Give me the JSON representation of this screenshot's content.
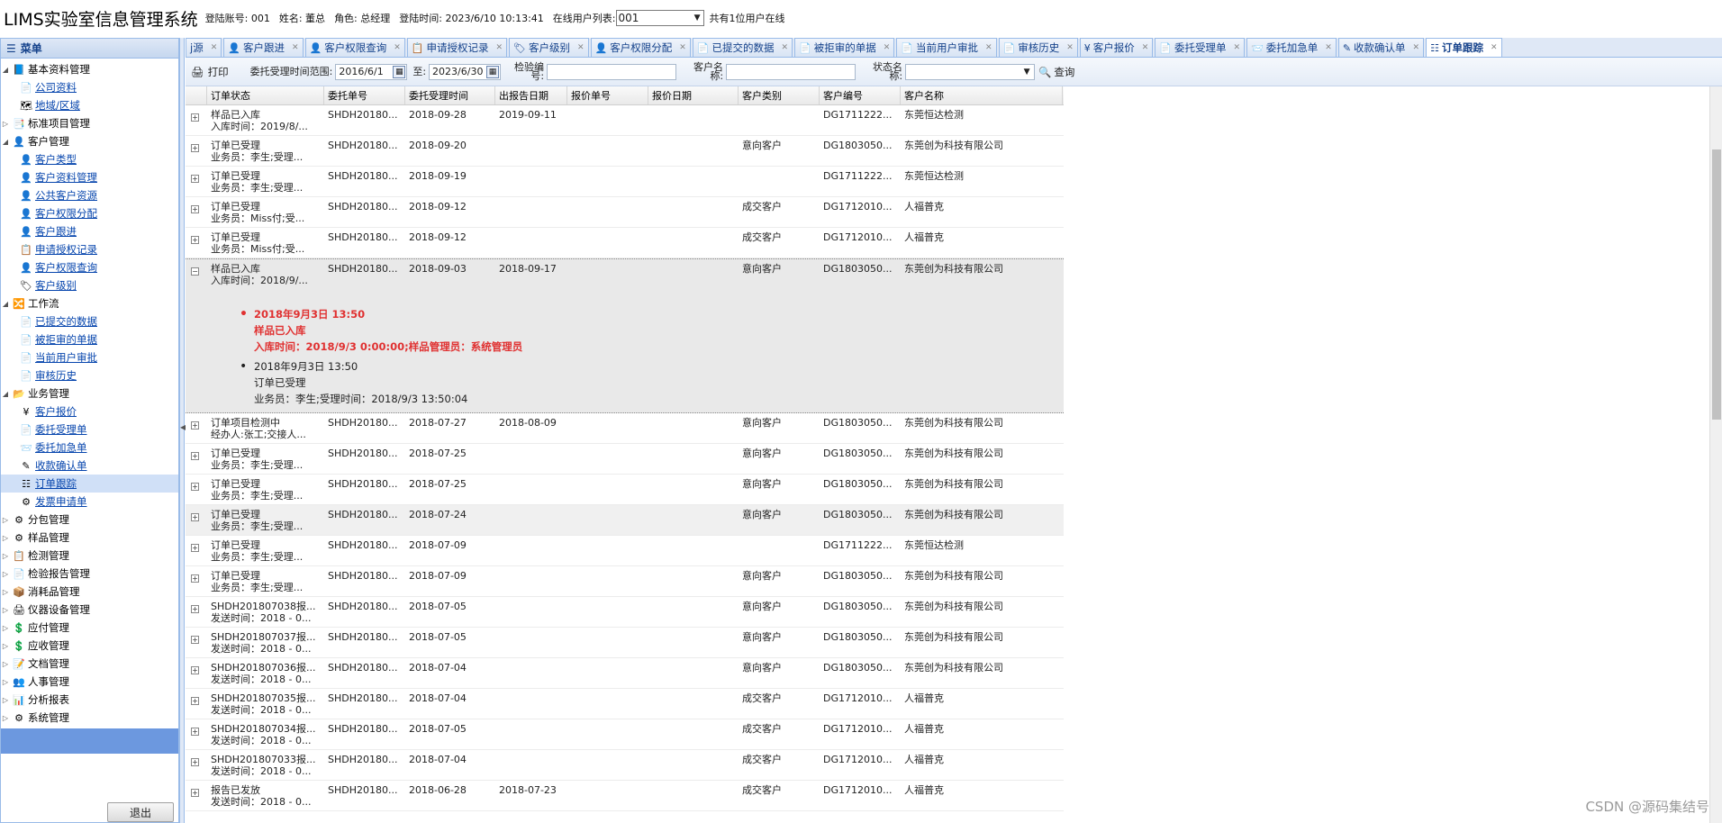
{
  "header": {
    "title": "LIMS实验室信息管理系统",
    "account": "登陆账号: 001",
    "name": "姓名: 董总",
    "role": "角色: 总经理",
    "login_time": "登陆时间: 2023/6/10 10:13:41",
    "online_label": "在线用户列表:",
    "online_value": "001",
    "online_count": "共有1位用户在线"
  },
  "menu": {
    "title": "菜单",
    "logout": "退出",
    "items": [
      {
        "label": "基本资料管理",
        "level": 0,
        "icon": "📘"
      },
      {
        "label": "公司资料",
        "level": 1,
        "icon": "📄"
      },
      {
        "label": "地域/区域",
        "level": 1,
        "icon": "🗺"
      },
      {
        "label": "标准项目管理",
        "level": 0,
        "icon": "📑"
      },
      {
        "label": "客户管理",
        "level": 0,
        "icon": "👤"
      },
      {
        "label": "客户类型",
        "level": 1,
        "icon": "👤"
      },
      {
        "label": "客户资料管理",
        "level": 1,
        "icon": "👤"
      },
      {
        "label": "公共客户资源",
        "level": 1,
        "icon": "👤"
      },
      {
        "label": "客户权限分配",
        "level": 1,
        "icon": "👤"
      },
      {
        "label": "客户跟进",
        "level": 1,
        "icon": "👤"
      },
      {
        "label": "申请授权记录",
        "level": 1,
        "icon": "📋"
      },
      {
        "label": "客户权限查询",
        "level": 1,
        "icon": "👤"
      },
      {
        "label": "客户级别",
        "level": 1,
        "icon": "🏷"
      },
      {
        "label": "工作流",
        "level": 0,
        "icon": "🔀"
      },
      {
        "label": "已提交的数据",
        "level": 1,
        "icon": "📄"
      },
      {
        "label": "被拒审的单据",
        "level": 1,
        "icon": "📄"
      },
      {
        "label": "当前用户审批",
        "level": 1,
        "icon": "📄"
      },
      {
        "label": "审核历史",
        "level": 1,
        "icon": "📄"
      },
      {
        "label": "业务管理",
        "level": 0,
        "icon": "📂"
      },
      {
        "label": "客户报价",
        "level": 1,
        "icon": "¥"
      },
      {
        "label": "委托受理单",
        "level": 1,
        "icon": "📄"
      },
      {
        "label": "委托加急单",
        "level": 1,
        "icon": "📨"
      },
      {
        "label": "收款确认单",
        "level": 1,
        "icon": "✎"
      },
      {
        "label": "订单跟踪",
        "level": 1,
        "icon": "☷"
      },
      {
        "label": "发票申请单",
        "level": 1,
        "icon": "⚙"
      },
      {
        "label": "分包管理",
        "level": 0,
        "icon": "⚙"
      },
      {
        "label": "样品管理",
        "level": 0,
        "icon": "⚙"
      },
      {
        "label": "检测管理",
        "level": 0,
        "icon": "📋"
      },
      {
        "label": "检验报告管理",
        "level": 0,
        "icon": "📄"
      },
      {
        "label": "消耗品管理",
        "level": 0,
        "icon": "📦"
      },
      {
        "label": "仪器设备管理",
        "level": 0,
        "icon": "🖨"
      },
      {
        "label": "应付管理",
        "level": 0,
        "icon": "💲"
      },
      {
        "label": "应收管理",
        "level": 0,
        "icon": "💲"
      },
      {
        "label": "文档管理",
        "level": 0,
        "icon": "📝"
      },
      {
        "label": "人事管理",
        "level": 0,
        "icon": "👥"
      },
      {
        "label": "分析报表",
        "level": 0,
        "icon": "📊"
      },
      {
        "label": "系统管理",
        "level": 0,
        "icon": "⚙"
      }
    ]
  },
  "tabs": [
    {
      "label": "j源",
      "icon": ""
    },
    {
      "label": "客户跟进",
      "icon": "👤"
    },
    {
      "label": "客户权限查询",
      "icon": "👤"
    },
    {
      "label": "申请授权记录",
      "icon": "📋"
    },
    {
      "label": "客户级别",
      "icon": "🏷"
    },
    {
      "label": "客户权限分配",
      "icon": "👤"
    },
    {
      "label": "已提交的数据",
      "icon": "📄"
    },
    {
      "label": "被拒审的单据",
      "icon": "📄"
    },
    {
      "label": "当前用户审批",
      "icon": "📄"
    },
    {
      "label": "审核历史",
      "icon": "📄"
    },
    {
      "label": "客户报价",
      "icon": "¥"
    },
    {
      "label": "委托受理单",
      "icon": "📄"
    },
    {
      "label": "委托加急单",
      "icon": "📨"
    },
    {
      "label": "收款确认单",
      "icon": "✎"
    },
    {
      "label": "订单跟踪",
      "icon": "☷"
    }
  ],
  "toolbar": {
    "print": "打印",
    "date_label": "委托受理时间范围:",
    "date_from": "2016/6/1",
    "to_label": "至:",
    "date_to": "2023/6/30",
    "test_no_label": "检验编号:",
    "customer_label": "客户名称:",
    "status_label": "状态名称:",
    "query": "查询"
  },
  "columns": [
    "订单状态",
    "委托单号",
    "委托受理时间",
    "出报告日期",
    "报价单号",
    "报价日期",
    "客户类别",
    "客户编号",
    "客户名称"
  ],
  "rows": [
    {
      "s1": "样品已入库",
      "s2": "入库时间：2019/8/...",
      "no": "SHDH20180...",
      "date": "2018-09-28",
      "report": "2019-09-11",
      "qno": "",
      "qdate": "",
      "type": "",
      "cno": "DG1711222...",
      "cname": "东莞恒达检测"
    },
    {
      "s1": "订单已受理",
      "s2": "业务员：李生;受理...",
      "no": "SHDH20180...",
      "date": "2018-09-20",
      "report": "",
      "qno": "",
      "qdate": "",
      "type": "意向客户",
      "cno": "DG1803050...",
      "cname": "东莞创为科技有限公司"
    },
    {
      "s1": "订单已受理",
      "s2": "业务员：李生;受理...",
      "no": "SHDH20180...",
      "date": "2018-09-19",
      "report": "",
      "qno": "",
      "qdate": "",
      "type": "",
      "cno": "DG1711222...",
      "cname": "东莞恒达检测"
    },
    {
      "s1": "订单已受理",
      "s2": "业务员：Miss付;受...",
      "no": "SHDH20180...",
      "date": "2018-09-12",
      "report": "",
      "qno": "",
      "qdate": "",
      "type": "成交客户",
      "cno": "DG1712010...",
      "cname": "人福普克"
    },
    {
      "s1": "订单已受理",
      "s2": "业务员：Miss付;受...",
      "no": "SHDH20180...",
      "date": "2018-09-12",
      "report": "",
      "qno": "",
      "qdate": "",
      "type": "成交客户",
      "cno": "DG1712010...",
      "cname": "人福普克"
    },
    {
      "s1": "样品已入库",
      "s2": "入库时间：2018/9/...",
      "no": "SHDH20180...",
      "date": "2018-09-03",
      "report": "2018-09-17",
      "qno": "",
      "qdate": "",
      "type": "意向客户",
      "cno": "DG1803050...",
      "cname": "东莞创为科技有限公司"
    },
    {
      "s1": "订单项目检测中",
      "s2": "经办人:张工;交接人...",
      "no": "SHDH20180...",
      "date": "2018-07-27",
      "report": "2018-08-09",
      "qno": "",
      "qdate": "",
      "type": "意向客户",
      "cno": "DG1803050...",
      "cname": "东莞创为科技有限公司"
    },
    {
      "s1": "订单已受理",
      "s2": "业务员：李生;受理...",
      "no": "SHDH20180...",
      "date": "2018-07-25",
      "report": "",
      "qno": "",
      "qdate": "",
      "type": "意向客户",
      "cno": "DG1803050...",
      "cname": "东莞创为科技有限公司"
    },
    {
      "s1": "订单已受理",
      "s2": "业务员：李生;受理...",
      "no": "SHDH20180...",
      "date": "2018-07-25",
      "report": "",
      "qno": "",
      "qdate": "",
      "type": "意向客户",
      "cno": "DG1803050...",
      "cname": "东莞创为科技有限公司"
    },
    {
      "s1": "订单已受理",
      "s2": "业务员：李生;受理...",
      "no": "SHDH20180...",
      "date": "2018-07-24",
      "report": "",
      "qno": "",
      "qdate": "",
      "type": "意向客户",
      "cno": "DG1803050...",
      "cname": "东莞创为科技有限公司"
    },
    {
      "s1": "订单已受理",
      "s2": "业务员：李生;受理...",
      "no": "SHDH20180...",
      "date": "2018-07-09",
      "report": "",
      "qno": "",
      "qdate": "",
      "type": "",
      "cno": "DG1711222...",
      "cname": "东莞恒达检测"
    },
    {
      "s1": "订单已受理",
      "s2": "业务员：李生;受理...",
      "no": "SHDH20180...",
      "date": "2018-07-09",
      "report": "",
      "qno": "",
      "qdate": "",
      "type": "意向客户",
      "cno": "DG1803050...",
      "cname": "东莞创为科技有限公司"
    },
    {
      "s1": "SHDH201807038报...",
      "s2": "发送时间：2018 - 0...",
      "no": "SHDH20180...",
      "date": "2018-07-05",
      "report": "",
      "qno": "",
      "qdate": "",
      "type": "意向客户",
      "cno": "DG1803050...",
      "cname": "东莞创为科技有限公司"
    },
    {
      "s1": "SHDH201807037报...",
      "s2": "发送时间：2018 - 0...",
      "no": "SHDH20180...",
      "date": "2018-07-05",
      "report": "",
      "qno": "",
      "qdate": "",
      "type": "意向客户",
      "cno": "DG1803050...",
      "cname": "东莞创为科技有限公司"
    },
    {
      "s1": "SHDH201807036报...",
      "s2": "发送时间：2018 - 0...",
      "no": "SHDH20180...",
      "date": "2018-07-04",
      "report": "",
      "qno": "",
      "qdate": "",
      "type": "意向客户",
      "cno": "DG1803050...",
      "cname": "东莞创为科技有限公司"
    },
    {
      "s1": "SHDH201807035报...",
      "s2": "发送时间：2018 - 0...",
      "no": "SHDH20180...",
      "date": "2018-07-04",
      "report": "",
      "qno": "",
      "qdate": "",
      "type": "成交客户",
      "cno": "DG1712010...",
      "cname": "人福普克"
    },
    {
      "s1": "SHDH201807034报...",
      "s2": "发送时间：2018 - 0...",
      "no": "SHDH20180...",
      "date": "2018-07-05",
      "report": "",
      "qno": "",
      "qdate": "",
      "type": "成交客户",
      "cno": "DG1712010...",
      "cname": "人福普克"
    },
    {
      "s1": "SHDH201807033报...",
      "s2": "发送时间：2018 - 0...",
      "no": "SHDH20180...",
      "date": "2018-07-04",
      "report": "",
      "qno": "",
      "qdate": "",
      "type": "成交客户",
      "cno": "DG1712010...",
      "cname": "人福普克"
    },
    {
      "s1": "报告已发放",
      "s2": "发送时间：2018 - 0...",
      "no": "SHDH20180...",
      "date": "2018-06-28",
      "report": "2018-07-23",
      "qno": "",
      "qdate": "",
      "type": "成交客户",
      "cno": "DG1712010...",
      "cname": "人福普克"
    }
  ],
  "expanded": {
    "row_index": 5,
    "entries": [
      {
        "time": "2018年9月3日 13:50",
        "status": "样品已入库",
        "detail": "入库时间：2018/9/3 0:00:00;样品管理员：系统管理员",
        "highlight": true
      },
      {
        "time": "2018年9月3日 13:50",
        "status": "订单已受理",
        "detail": "业务员：李生;受理时间：2018/9/3 13:50:04",
        "highlight": false
      }
    ]
  },
  "watermark": "CSDN @源码集结号"
}
